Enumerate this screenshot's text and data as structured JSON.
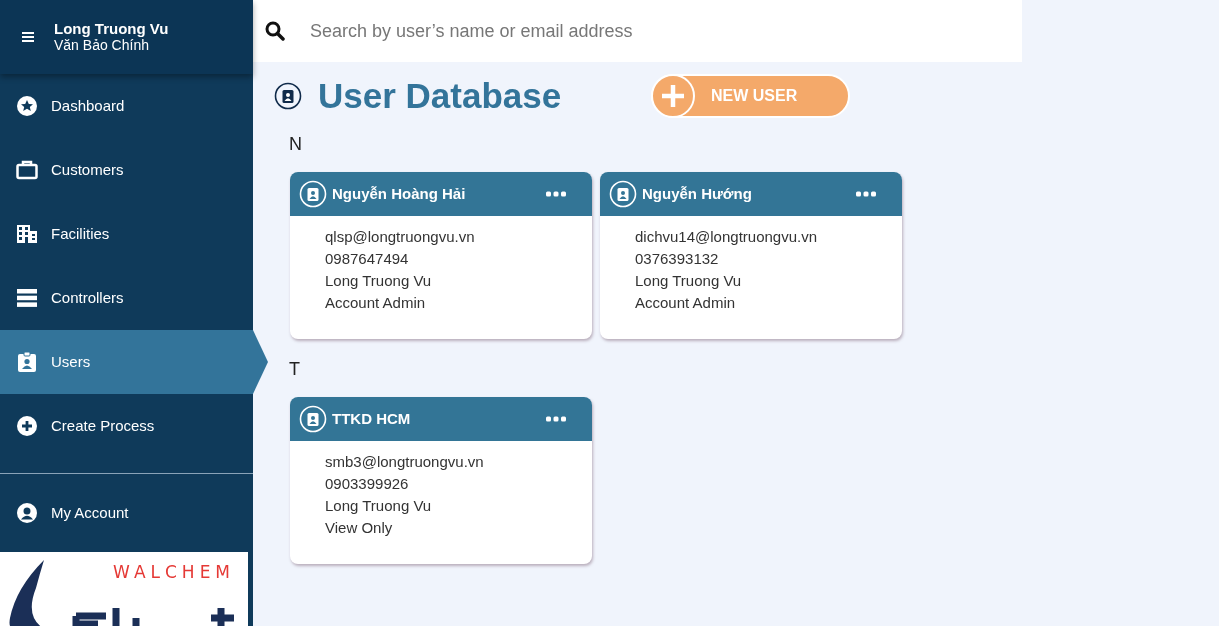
{
  "sidebar": {
    "header": {
      "title": "Long Truong Vu",
      "subtitle": "Văn Bảo Chính"
    },
    "items": [
      {
        "kind": "star",
        "label": "Dashboard",
        "selected": false
      },
      {
        "kind": "briefcase",
        "label": "Customers",
        "selected": false
      },
      {
        "kind": "building",
        "label": "Facilities",
        "selected": false
      },
      {
        "kind": "server",
        "label": "Controllers",
        "selected": false
      },
      {
        "kind": "badge",
        "label": "Users",
        "selected": true
      },
      {
        "kind": "plus",
        "label": "Create Process",
        "selected": false
      }
    ],
    "account": {
      "label": "My Account"
    },
    "logo": {
      "text": "WALCHEM"
    }
  },
  "search": {
    "placeholder": "Search by user’s name or email address"
  },
  "page": {
    "title": "User Database",
    "new_button": "NEW USER"
  },
  "groups": [
    {
      "letter": "N",
      "users": [
        {
          "name": "Nguyễn Hoàng Hải",
          "email": "qlsp@longtruongvu.vn",
          "phone": "0987647494",
          "company": "Long Truong Vu",
          "role": "Account Admin"
        },
        {
          "name": "Nguyễn Hướng",
          "email": "dichvu14@longtruongvu.vn",
          "phone": "0376393132",
          "company": "Long Truong Vu",
          "role": "Account Admin"
        }
      ]
    },
    {
      "letter": "T",
      "users": [
        {
          "name": "TTKD HCM",
          "email": "smb3@longtruongvu.vn",
          "phone": "0903399926",
          "company": "Long Truong Vu",
          "role": "View Only"
        }
      ]
    }
  ]
}
